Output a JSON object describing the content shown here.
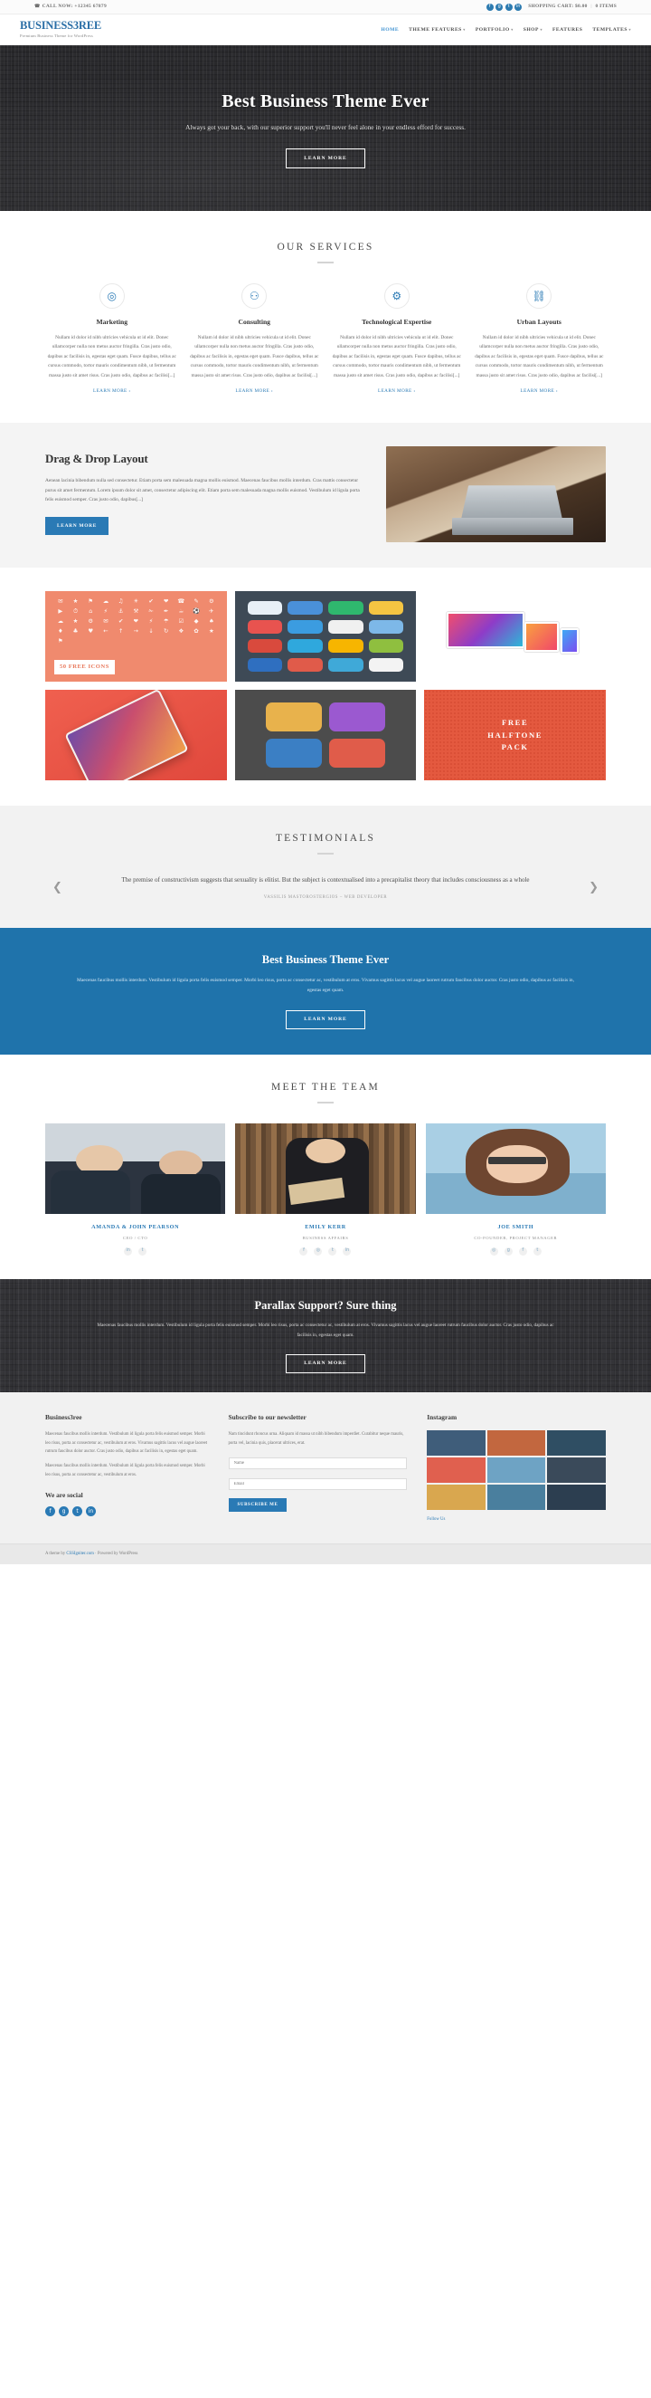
{
  "topbar": {
    "phone_icon": "phone-icon",
    "call_text": "CALL NOW: +12345 67879",
    "socials": [
      {
        "name": "facebook-icon",
        "glyph": "f"
      },
      {
        "name": "google-plus-icon",
        "glyph": "g"
      },
      {
        "name": "twitter-icon",
        "glyph": "t"
      },
      {
        "name": "linkedin-icon",
        "glyph": "in"
      }
    ],
    "cart_label": "SHOPPING CART: $0.00",
    "cart_separator": "|",
    "cart_items": "0 ITEMS"
  },
  "header": {
    "logo": "BUSINESS3REE",
    "tagline": "Premium Business Theme for WordPress",
    "nav": [
      {
        "label": "HOME",
        "active": true,
        "caret": false
      },
      {
        "label": "THEME FEATURES",
        "active": false,
        "caret": true
      },
      {
        "label": "PORTFOLIO",
        "active": false,
        "caret": true
      },
      {
        "label": "SHOP",
        "active": false,
        "caret": true
      },
      {
        "label": "FEATURES",
        "active": false,
        "caret": false
      },
      {
        "label": "TEMPLATES",
        "active": false,
        "caret": true
      }
    ]
  },
  "hero": {
    "title": "Best Business Theme Ever",
    "subtitle": "Always got your back, with our superior support you'll never feel alone in your endless efford for success.",
    "button": "LEARN MORE"
  },
  "services": {
    "title": "OUR SERVICES",
    "body_text": "Nullam id dolor id nibh ultricies vehicula ut id elit. Donec ullamcorper nulla non metus auctor fringilla. Cras justo odio, dapibus ac facilisis in, egestas eget quam. Fusce dapibus, tellus ac cursus commodo, tortor mauris condimentum nibh, ut fermentum massa justo sit amet risus. Cras justo odio, dapibus ac facilisi[...]",
    "more_label": "LEARN MORE ›",
    "items": [
      {
        "title": "Marketing",
        "icon": "bullseye-icon",
        "glyph": "◎"
      },
      {
        "title": "Consulting",
        "icon": "users-icon",
        "glyph": "⚇"
      },
      {
        "title": "Technological Expertise",
        "icon": "gears-icon",
        "glyph": "⚙"
      },
      {
        "title": "Urban Layouts",
        "icon": "sitemap-icon",
        "glyph": "⛓"
      }
    ]
  },
  "dragdrop": {
    "title": "Drag & Drop Layout",
    "text": "Aenean lacinia bibendum nulla sed consectetur. Etiam porta sem malesuada magna mollis euismod. Maecenas faucibus mollis interdum. Cras mattis consectetur purus sit amet fermentum. Lorem ipsum dolor sit amet, consectetur adipiscing elit. Etiam porta sem malesuada magna mollis euismod. Vestibulum id ligula porta felis euismod semper. Cras justo odio, dapibus[...]",
    "button": "LEARN MORE",
    "image_name": "laptop-desk-photo"
  },
  "portfolio": {
    "cells": [
      {
        "name": "free-icons-tile",
        "badge": "50 FREE ICONS"
      },
      {
        "name": "app-icons-tile",
        "badge": ""
      },
      {
        "name": "devices-mockup-tile",
        "badge": ""
      },
      {
        "name": "phone-mockup-tile",
        "badge": ""
      },
      {
        "name": "flat-icons-tile",
        "badge": ""
      },
      {
        "name": "halftone-pack-tile",
        "badge": "FREE\nHALFTONE\nPACK"
      }
    ],
    "halftone_lines": [
      "FREE",
      "HALFTONE",
      "PACK"
    ],
    "icon_glyphs": [
      "✉",
      "★",
      "⚑",
      "☁",
      "♫",
      "☀",
      "✔",
      "❤",
      "☎",
      "✎",
      "⚙",
      "▶",
      "⏱",
      "⌂",
      "⚡",
      "⚓",
      "⚒",
      "✁",
      "✒",
      "☕",
      "⚽",
      "✈",
      "☁",
      "★",
      "⚙",
      "✉",
      "✔",
      "❤",
      "⚡",
      "☂",
      "☑",
      "◆",
      "♠",
      "♦",
      "♣",
      "♥",
      "←",
      "↑",
      "→",
      "↓",
      "↻",
      "❖",
      "✿",
      "★",
      "⚑"
    ],
    "app_colors": [
      "#e8f0f7",
      "#4a90d9",
      "#2fb86e",
      "#f5c542",
      "#e8534f",
      "#3b9ce0",
      "#f0f0f0",
      "#7db8e8",
      "#d94a3d",
      "#2fa8dd",
      "#f7b500",
      "#8fbf3f",
      "#2f6fc0",
      "#e05b4a",
      "#3fa9d8",
      "#f3f3f3"
    ],
    "flat_colors": [
      "#e8b24c",
      "#9b59d0",
      "#3b7fc4",
      "#e05c4a"
    ]
  },
  "testimonials": {
    "title": "TESTIMONIALS",
    "quote": "The premise of constructivism suggests that sexuality is elitist. But the subject is contextualised into a precapitalist theory that includes consciousness as a whole",
    "author": "VASSILIS MASTOROSTERGIOS – WEB DEVELOPER",
    "prev_icon": "chevron-left-icon",
    "next_icon": "chevron-right-icon"
  },
  "cta": {
    "title": "Best Business Theme Ever",
    "text": "Maecenas faucibus mollis interdum. Vestibulum id ligula porta felis euismod semper. Morbi leo risus, porta ac consectetur ac, vestibulum at eros. Vivamus sagittis lacus vel augue laoreet rutrum faucibus dolor auctor. Cras justo odio, dapibus ac facilisis in, egestas eget quam.",
    "button": "LEARN MORE",
    "accent": "#1f73ab"
  },
  "team": {
    "title": "MEET THE TEAM",
    "members": [
      {
        "name": "AMANDA & JOHN PEARSON",
        "role": "CEO / CTO",
        "photo": "team-photo-1",
        "socials": [
          {
            "name": "linkedin-icon",
            "glyph": "in"
          },
          {
            "name": "twitter-icon",
            "glyph": "t"
          }
        ]
      },
      {
        "name": "EMILY KERR",
        "role": "BUSINESS AFFAIRS",
        "photo": "team-photo-2",
        "socials": [
          {
            "name": "facebook-icon",
            "glyph": "f"
          },
          {
            "name": "instagram-icon",
            "glyph": "◎"
          },
          {
            "name": "twitter-icon",
            "glyph": "t"
          },
          {
            "name": "linkedin-icon",
            "glyph": "in"
          }
        ]
      },
      {
        "name": "JOE SMITH",
        "role": "CO-FOUNDER, PROJECT MANAGER",
        "photo": "team-photo-3",
        "socials": [
          {
            "name": "instagram-icon",
            "glyph": "◎"
          },
          {
            "name": "google-plus-icon",
            "glyph": "g"
          },
          {
            "name": "facebook-icon",
            "glyph": "f"
          },
          {
            "name": "twitter-icon",
            "glyph": "t"
          }
        ]
      }
    ]
  },
  "parallax": {
    "title": "Parallax Support? Sure thing",
    "text": "Maecenas faucibus mollis interdum. Vestibulum id ligula porta felis euismod semper. Morbi leo risus, porta ac consectetur ac, vestibulum at eros. Vivamus sagittis lacus vel augue laoreet rutrum faucibus dolor auctor. Cras justo odio, dapibus ac facilisis in, egestas eget quam.",
    "button": "LEARN MORE"
  },
  "footer": {
    "about": {
      "title": "Business3ree",
      "p1": "Maecenas faucibus mollis interdum. Vestibulum id ligula porta felis euismod semper. Morbi leo risus, porta ac consectetur ac, vestibulum at eros. Vivamus sagittis lacus vel augue laoreet rutrum faucibus dolor auctor. Cras justo odio, dapibus ac facilisis in, egestas eget quam.",
      "p2": "Maecenas faucibus mollis interdum. Vestibulum id ligula porta felis euismod semper. Morbi leo risus, porta ac consectetur ac, vestibulum at eros."
    },
    "social_title": "We are social",
    "socials": [
      {
        "name": "facebook-icon",
        "glyph": "f"
      },
      {
        "name": "google-plus-icon",
        "glyph": "g"
      },
      {
        "name": "twitter-icon",
        "glyph": "t"
      },
      {
        "name": "linkedin-icon",
        "glyph": "in"
      }
    ],
    "newsletter": {
      "title": "Subscribe to our newsletter",
      "text": "Nam tincidunt rhoncus urna. Aliquam id massa ut nibh bibendum imperdiet. Curabitur neque mauris, porta vel, lacinia quis, placerat ultrices, erat.",
      "name_placeholder": "Name",
      "email_placeholder": "Email",
      "button": "SUBSCRIBE ME"
    },
    "instagram": {
      "title": "Instagram",
      "follow": "Follow Us",
      "tile_colors": [
        "#3f5d7a",
        "#c2673f",
        "#2f4e63",
        "#e0604f",
        "#6ea3c4",
        "#3a4a5a",
        "#d9a74f",
        "#4a7f9e",
        "#2c3e50"
      ]
    }
  },
  "copyright": {
    "left_prefix": "A theme by ",
    "left_link": "CSSIgniter.com",
    "left_suffix": " · Powered by WordPress"
  }
}
